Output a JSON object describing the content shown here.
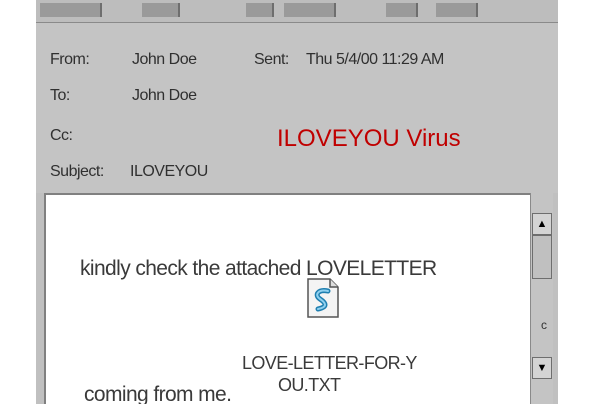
{
  "email": {
    "from_label": "From:",
    "from_value": "John Doe",
    "sent_label": "Sent:",
    "sent_value": "Thu 5/4/00 11:29 AM",
    "to_label": "To:",
    "to_value": "John Doe",
    "cc_label": "Cc:",
    "subject_label": "Subject:",
    "subject_value": "ILOVEYOU"
  },
  "annotation": "ILOVEYOU Virus",
  "body": {
    "line1": "kindly check the attached LOVELETTER",
    "line2": "coming from me."
  },
  "attachment": {
    "name_line1": "LOVE-LETTER-FOR-Y",
    "name_line2": "OU.TXT",
    "icon": "script-file-icon"
  },
  "scrollbar": {
    "up_arrow": "▲",
    "down_arrow": "▼"
  },
  "stray_mark": "c",
  "colors": {
    "annotation": "#c00000",
    "window_gray": "#c4c4c4"
  }
}
